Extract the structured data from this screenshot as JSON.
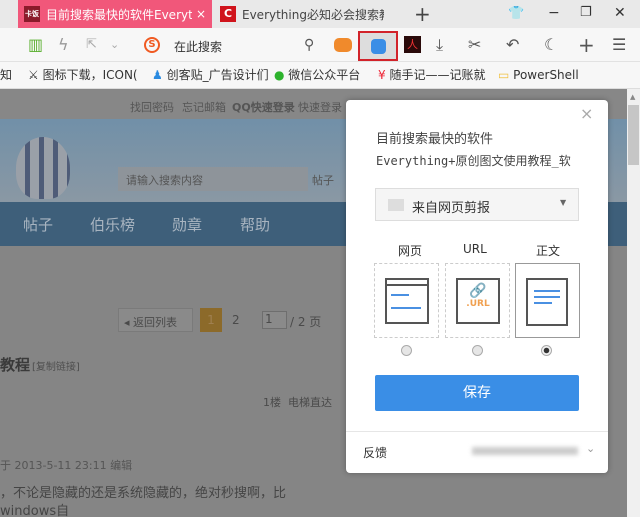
{
  "tabs": [
    {
      "label": "目前搜索最快的软件Everything",
      "favicon": "卡饭",
      "active": true,
      "close": "×"
    },
    {
      "label": "Everything必知必会搜索教程",
      "favicon": "C",
      "active": false
    }
  ],
  "window": {
    "new_tab": "+",
    "skin": "shirt-icon",
    "minimize": "−",
    "restore": "❐",
    "close": "✕"
  },
  "toolbar": {
    "search_placeholder": "在此搜索",
    "search_engine_icon": "S"
  },
  "bookmarks": [
    "知",
    "图标下载，ICON(",
    "创客贴_广告设计们",
    "微信公众平台",
    "随手记——记账就",
    "PowerShell"
  ],
  "page": {
    "top_links": [
      "找回密码",
      "忘记邮箱",
      "QQ快速登录",
      "快速登录"
    ],
    "search_placeholder": "请输入搜索内容",
    "search_type": "帖子",
    "nav": [
      "帖子",
      "伯乐榜",
      "勋章",
      "帮助"
    ],
    "back_list": "◂ 返回列表",
    "pages": [
      "1",
      "2"
    ],
    "page_input": "1",
    "page_total": "/ 2 页",
    "title": "教程",
    "copy_link": "[复制链接]",
    "floor": "1楼",
    "floor_link": "电梯直达",
    "posted": "于 2013-5-11 23:11 编辑",
    "body": "，不论是隐藏的还是系统隐藏的，绝对秒搜啊，比windows自"
  },
  "clipper": {
    "title_line1": "目前搜索最快的软件",
    "title_line2": "Everything+原创图文使用教程_软",
    "folder": "来自网页剪报",
    "options": [
      {
        "label": "网页",
        "selected": false
      },
      {
        "label": "URL",
        "selected": false,
        "icon_text": ".URL"
      },
      {
        "label": "正文",
        "selected": true
      }
    ],
    "save": "保存",
    "feedback": "反馈",
    "accent": "#3a8ee6"
  }
}
